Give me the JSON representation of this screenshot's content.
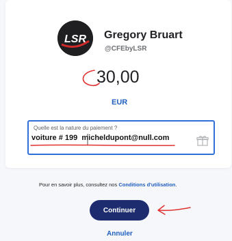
{
  "profile": {
    "avatar_text": "LSR",
    "name": "Gregory Bruart",
    "handle": "@CFEbyLSR"
  },
  "payment": {
    "amount": "30,00",
    "currency": "EUR"
  },
  "note_field": {
    "label": "Quelle est la nature du paiement ?",
    "value": "voiture # 199  micheldupont@null.com"
  },
  "terms": {
    "text": "Pour en savoir plus, consultez nos",
    "link": "Conditions d'utilisation",
    "suffix": "."
  },
  "actions": {
    "continue_label": "Continuer",
    "cancel_label": "Annuler"
  },
  "icons": {
    "gift": "gift-icon"
  },
  "colors": {
    "accent_blue": "#2f6fd8",
    "button_navy": "#1c2c6e",
    "link_blue": "#1f5fbf",
    "annotation_red": "#e03030"
  }
}
